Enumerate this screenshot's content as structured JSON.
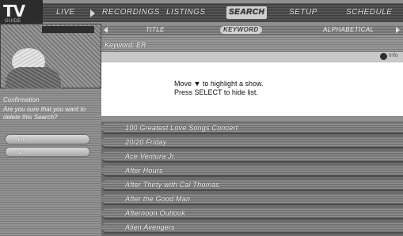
{
  "nav": {
    "items": [
      "LIVE",
      "RECORDINGS",
      "LISTINGS",
      "SEARCH",
      "SETUP",
      "SCHEDULE"
    ],
    "active_index": 3
  },
  "logo": {
    "text": "TV",
    "subtext": "GUIDE"
  },
  "sidebar": {
    "title": "Confirmation",
    "message": "Are you sure that you want to delete this Search?",
    "options": [
      "Yes",
      "No"
    ]
  },
  "tabs": {
    "items": [
      "TITLE",
      "KEYWORD",
      "ALPHABETICAL"
    ],
    "active_index": 1
  },
  "keyword": {
    "label": "Keyword: ER"
  },
  "info_bar": {
    "text": "Info"
  },
  "message": {
    "line1": "Move ▼ to highlight a show.",
    "line2": "Press SELECT to hide list."
  },
  "results": [
    "100 Greatest Love Songs Concert",
    "20/20 Friday",
    "Ace Ventura Jr.",
    "After Hours",
    "After Thirty with Cal Thomas",
    "After the Good Man",
    "Afternoon Outlook",
    "Alien Avengers"
  ]
}
